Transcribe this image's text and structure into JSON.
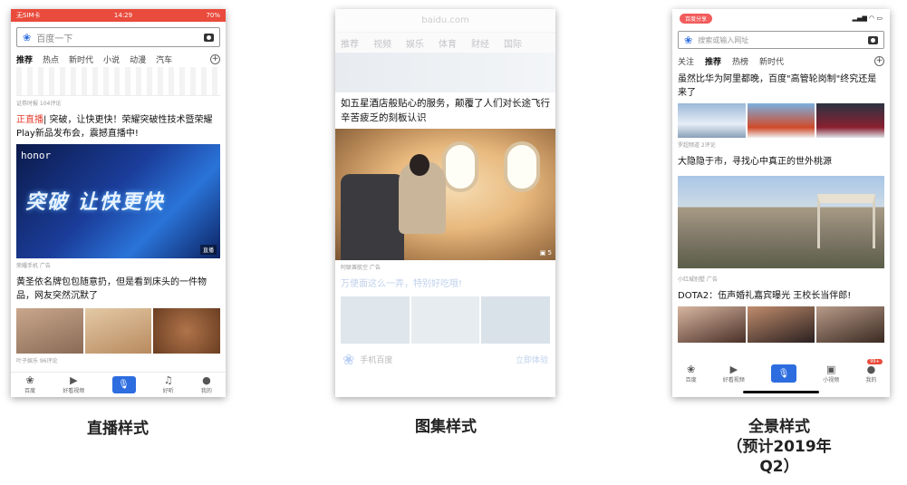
{
  "captions": {
    "live": "直播样式",
    "gallery": "图集样式",
    "panorama_line1": "全景样式",
    "panorama_line2": "（预计2019年",
    "panorama_line3": "Q2）"
  },
  "phone1": {
    "status": {
      "carrier": "无SIM卡",
      "time": "14:29",
      "battery": "70%"
    },
    "search": {
      "placeholder": "百度一下"
    },
    "tabs": [
      "推荐",
      "热点",
      "新时代",
      "小说",
      "动漫",
      "汽车"
    ],
    "meta_top": "证券时报  104评论",
    "article1": {
      "live_label": "正直播",
      "title": "| 突破，让快更快！荣耀突破性技术暨荣耀Play新品发布会，震撼直播中!",
      "banner_brand": "honor",
      "banner_slogan": "突破 让快更快",
      "banner_tag": "直播",
      "meta": "荣耀手机  广告"
    },
    "article2": {
      "title": "黄圣依名牌包包随意扔，但是看到床头的一件物品，网友突然沉默了",
      "meta": "叶子娱乐  96评论"
    },
    "nav": [
      "百度",
      "好看视频",
      "",
      "好听",
      "我的"
    ]
  },
  "phone2": {
    "url": "baidu.com",
    "tabs": [
      "推荐",
      "视频",
      "娱乐",
      "体育",
      "财经",
      "国际"
    ],
    "article": {
      "title": "如五星酒店般贴心的服务，颠覆了人们对长途飞行辛苦疲乏的刻板认识",
      "count": "5",
      "meta": "阿联酋航空  广告"
    },
    "article2": {
      "title": "万便面这么一弄，特别好吃哦!"
    },
    "ad": {
      "name": "手机百度",
      "desc": "立即体验"
    }
  },
  "phone3": {
    "status": {
      "pill": "百度分享"
    },
    "search": {
      "placeholder": "搜索或输入网址"
    },
    "tabs": [
      "关注",
      "推荐",
      "热榜",
      "新时代"
    ],
    "article1": {
      "title": "虽然比华为阿里都晚，百度\"高管轮岗制\"终究还是来了",
      "meta": "罗超频道  2评论"
    },
    "article2": {
      "title": "大隐隐于市，寻找心中真正的世外桃源",
      "meta": "小红城别墅  广告"
    },
    "article3": {
      "title": "DOTA2：伍声婚礼嘉宾曝光 王校长当伴郎!"
    },
    "nav": [
      "百度",
      "好看视频",
      "",
      "小视频",
      "我的"
    ],
    "badge": "99+"
  },
  "colors": {
    "accent": "#2d6de0",
    "status_red": "#e94b3c",
    "live_red": "#e43a2b"
  }
}
